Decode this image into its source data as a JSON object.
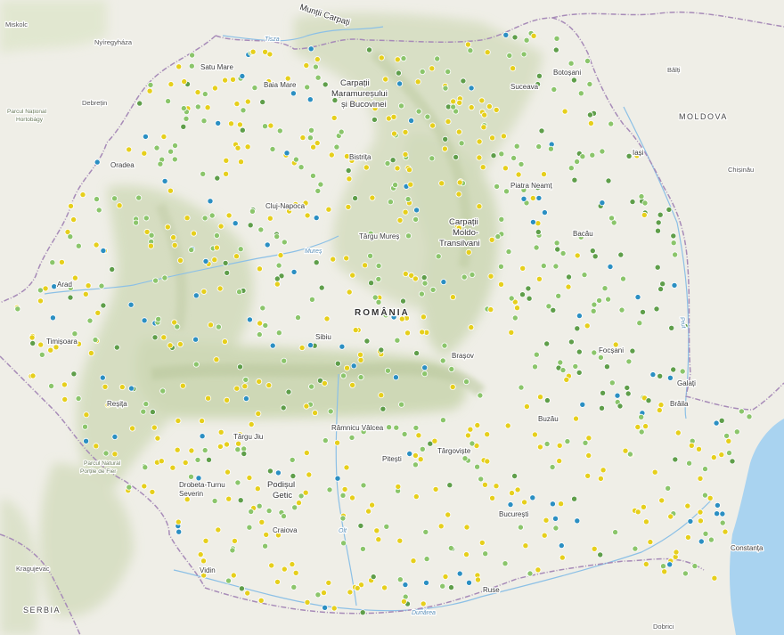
{
  "map": {
    "colors": {
      "land": "#efeee7",
      "relief": "#d7dfc3",
      "relief_dark": "#c2cfa9",
      "sea": "#a9d3f0",
      "border": "#a78bb8",
      "river": "#8cc0e6"
    },
    "marker_colors": {
      "yellow": "#e6cf1c",
      "lightgreen": "#8bc56b",
      "darkgreen": "#5f9e4a",
      "blue": "#2b8fc2"
    },
    "labels": {
      "country_main": "ROMÂNIA",
      "country_moldova": "MOLDOVA",
      "country_serbia": "SERBIA",
      "mountains_top": "Munții Carpați",
      "region_maramures": [
        "Carpații",
        "Maramureșului",
        "și Bucovinei"
      ],
      "region_moldo": [
        "Carpații",
        "Moldo-",
        "Transilvani"
      ],
      "region_getic": [
        "Podișul",
        "Getic"
      ],
      "park_hortobagy": [
        "Parcul Național",
        "Hortobágy"
      ],
      "park_portile": [
        "Parcul Natural",
        "Porțile de Fier"
      ],
      "river_tisza": "Tisza",
      "river_mures": "Mureș",
      "river_prut": "Prut",
      "river_olt": "Olt",
      "river_dunarea": "Dunărea",
      "cities": {
        "miskolc": "Miskolc",
        "nyiregyhaza": "Nyíregyháza",
        "debrecen": "Debrețin",
        "satu_mare": "Satu Mare",
        "baia_mare": "Baia Mare",
        "oradea": "Oradea",
        "suceava": "Suceava",
        "botosani": "Botoșani",
        "balti": "Bălți",
        "bistrita": "Bistrița",
        "iasi": "Iași",
        "chisinau": "Chișinău",
        "piatra_neamt": "Piatra Neamț",
        "cluj": "Cluj-Napoca",
        "targu_mures": "Târgu Mureș",
        "bacau": "Bacău",
        "arad": "Arad",
        "timisoara": "Timișoara",
        "sibiu": "Sibiu",
        "brasov": "Brașov",
        "focsani": "Focșani",
        "galati": "Galați",
        "braila": "Brăila",
        "resita": "Reșița",
        "buzau": "Buzău",
        "targu_jiu": "Târgu Jiu",
        "ramnicu": "Râmnicu Vâlcea",
        "pitesti": "Pitești",
        "targoviste": "Târgoviște",
        "drobeta": [
          "Drobeta-Turnu",
          "Severin"
        ],
        "craiova": "Craiova",
        "bucuresti": "București",
        "constanta": "Constanța",
        "kragujevac": "Kragujevac",
        "vidin": "Vidin",
        "ruse": "Ruse",
        "dobrici": "Dobrici"
      }
    }
  }
}
